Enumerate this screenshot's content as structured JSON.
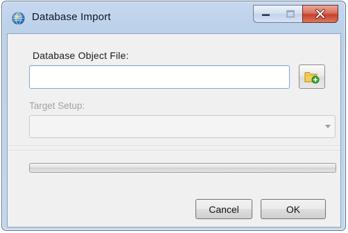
{
  "window": {
    "title": "Database Import",
    "icon": "globe-icon"
  },
  "controls": {
    "minimize_icon": "minimize-icon",
    "maximize_icon": "maximize-icon",
    "close_icon": "close-icon"
  },
  "form": {
    "file_label": "Database Object File:",
    "file_value": "",
    "browse_icon": "folder-add-icon",
    "target_label": "Target Setup:",
    "target_value": ""
  },
  "progress": {
    "value": 0
  },
  "buttons": {
    "cancel": "Cancel",
    "ok": "OK"
  },
  "colors": {
    "close_red": "#c8402a",
    "titlebar_blue": "#bcd1ea",
    "input_border": "#7fa8d8",
    "disabled_text": "#a2a2a2"
  }
}
